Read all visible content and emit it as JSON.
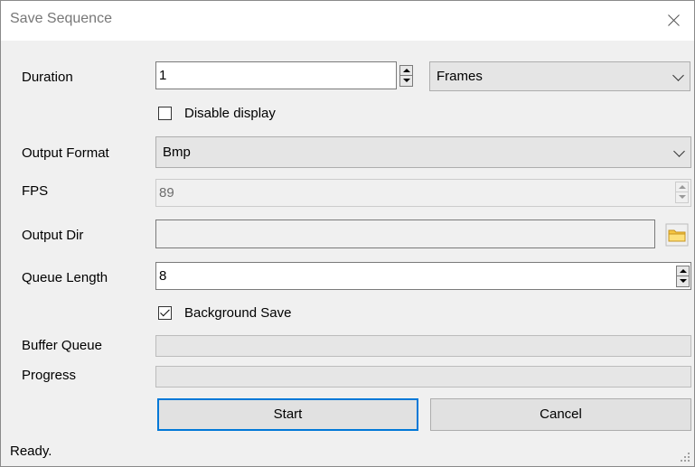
{
  "window": {
    "title": "Save Sequence"
  },
  "duration": {
    "label": "Duration",
    "value": "1",
    "unit": "Frames"
  },
  "disable_display": {
    "label": "Disable display",
    "checked": false
  },
  "output_format": {
    "label": "Output Format",
    "value": "Bmp"
  },
  "fps": {
    "label": "FPS",
    "value": "89",
    "enabled": false
  },
  "output_dir": {
    "label": "Output Dir",
    "value": ""
  },
  "queue_length": {
    "label": "Queue Length",
    "value": "8"
  },
  "background_save": {
    "label": "Background Save",
    "checked": true
  },
  "buffer_queue": {
    "label": "Buffer Queue",
    "progress": 0
  },
  "progress": {
    "label": "Progress",
    "progress": 0
  },
  "buttons": {
    "start": "Start",
    "cancel": "Cancel"
  },
  "status": {
    "text": "Ready."
  },
  "icons": {
    "close": "close-icon",
    "dropdown": "chevron-down-icon",
    "spin": "spinner-arrows-icon",
    "folder": "folder-icon",
    "check": "checkmark-icon",
    "grip": "resize-grip-icon"
  }
}
